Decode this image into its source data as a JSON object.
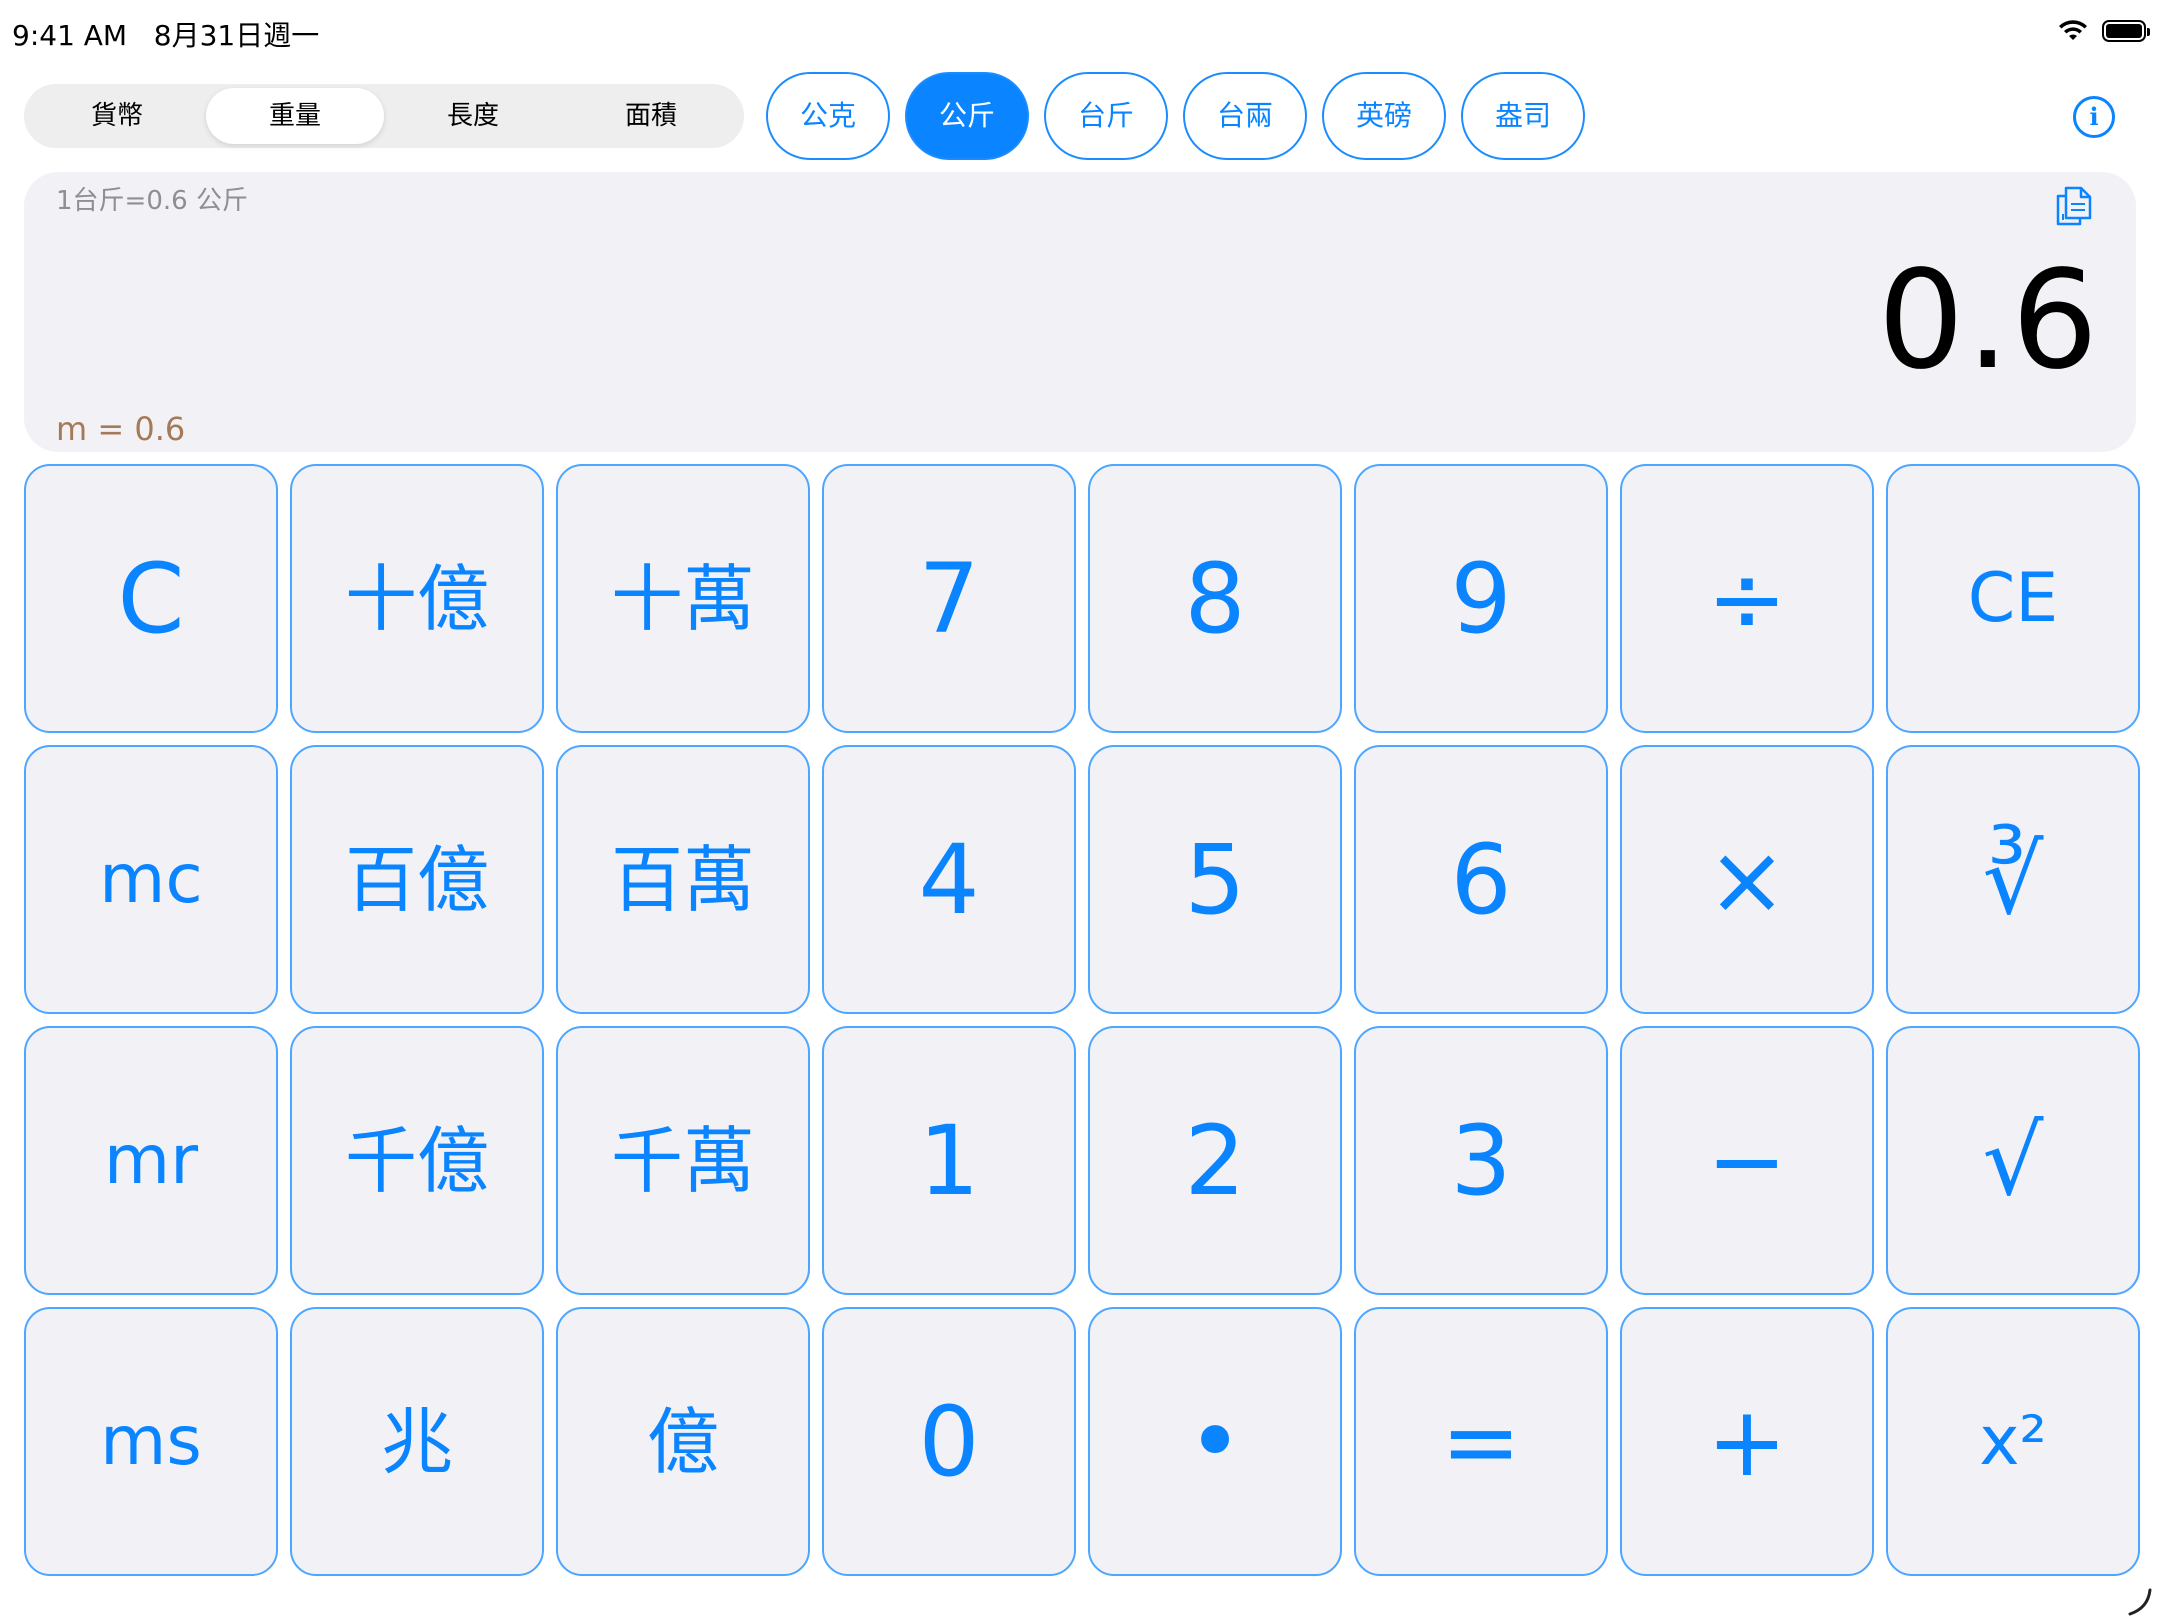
{
  "status_bar": {
    "time": "9:41 AM",
    "date": "8月31日週一",
    "icons": [
      "wifi-icon",
      "battery-icon"
    ]
  },
  "category_tabs": {
    "items": [
      "貨幣",
      "重量",
      "長度",
      "面積"
    ],
    "selected": "重量"
  },
  "unit_pills": {
    "items": [
      "公克",
      "公斤",
      "台斤",
      "台兩",
      "英磅",
      "盎司"
    ],
    "selected": "公斤"
  },
  "info_button": {
    "icon": "info-icon",
    "glyph": "i"
  },
  "display": {
    "conversion_rate": "1台斤=0.6 公斤",
    "value": "0.6",
    "memory": "m = 0.6",
    "copy_icon": "copy-icon"
  },
  "keypad": {
    "rows": [
      [
        "C",
        "十億",
        "十萬",
        "7",
        "8",
        "9",
        "÷",
        "CE"
      ],
      [
        "mc",
        "百億",
        "百萬",
        "4",
        "5",
        "6",
        "×",
        "∛"
      ],
      [
        "mr",
        "千億",
        "千萬",
        "1",
        "2",
        "3",
        "−",
        "√"
      ],
      [
        "ms",
        "兆",
        "億",
        "0",
        "•",
        "=",
        "+",
        "x²"
      ]
    ]
  },
  "colors": {
    "accent": "#0a84ff",
    "key_background": "#f2f2f6",
    "key_border": "#4da6ff",
    "memory_text": "#a57a58",
    "secondary_text": "#8e8e93"
  }
}
